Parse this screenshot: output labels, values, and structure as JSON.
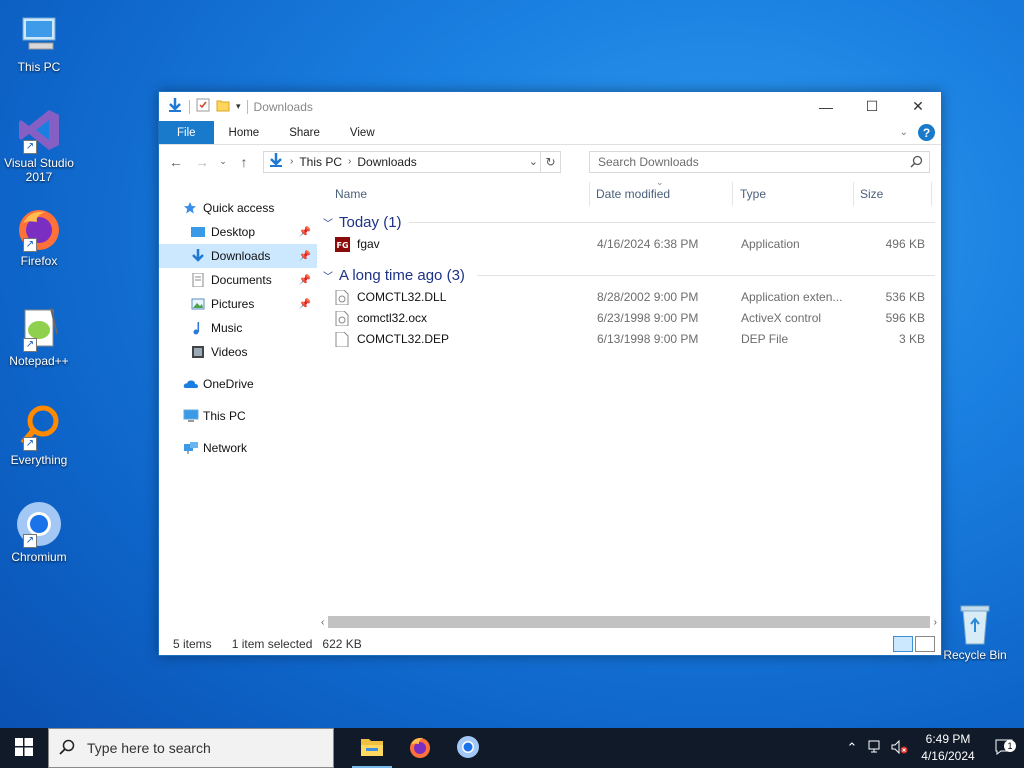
{
  "desktop": {
    "icons": [
      {
        "label": "This PC"
      },
      {
        "label": "Visual Studio 2017"
      },
      {
        "label": "Firefox"
      },
      {
        "label": "Notepad++"
      },
      {
        "label": "Everything"
      },
      {
        "label": "Chromium"
      }
    ],
    "recycle_bin": "Recycle Bin"
  },
  "window": {
    "title": "Downloads",
    "ribbon_tabs": [
      "File",
      "Home",
      "Share",
      "View"
    ],
    "address": {
      "root": "This PC",
      "folder": "Downloads"
    },
    "search_placeholder": "Search Downloads",
    "nav": {
      "quick_access": "Quick access",
      "items": [
        "Desktop",
        "Downloads",
        "Documents",
        "Pictures",
        "Music",
        "Videos"
      ],
      "onedrive": "OneDrive",
      "this_pc": "This PC",
      "network": "Network"
    },
    "columns": {
      "name": "Name",
      "date": "Date modified",
      "type": "Type",
      "size": "Size"
    },
    "groups": [
      {
        "title": "Today (1)",
        "files": [
          {
            "name": "fgav",
            "date": "4/16/2024 6:38 PM",
            "type": "Application",
            "size": "496 KB"
          }
        ]
      },
      {
        "title": "A long time ago (3)",
        "files": [
          {
            "name": "COMCTL32.DLL",
            "date": "8/28/2002 9:00 PM",
            "type": "Application exten...",
            "size": "536 KB"
          },
          {
            "name": "comctl32.ocx",
            "date": "6/23/1998 9:00 PM",
            "type": "ActiveX control",
            "size": "596 KB"
          },
          {
            "name": "COMCTL32.DEP",
            "date": "6/13/1998 9:00 PM",
            "type": "DEP File",
            "size": "3 KB"
          }
        ]
      }
    ],
    "status": {
      "items": "5 items",
      "selected": "1 item selected",
      "selected_size": "622 KB"
    }
  },
  "taskbar": {
    "search_placeholder": "Type here to search",
    "time": "6:49 PM",
    "date": "4/16/2024",
    "notification_count": "1"
  },
  "colors": {
    "accent": "#1979ca",
    "selected": "#cce8ff",
    "taskbar": "#101a28"
  }
}
